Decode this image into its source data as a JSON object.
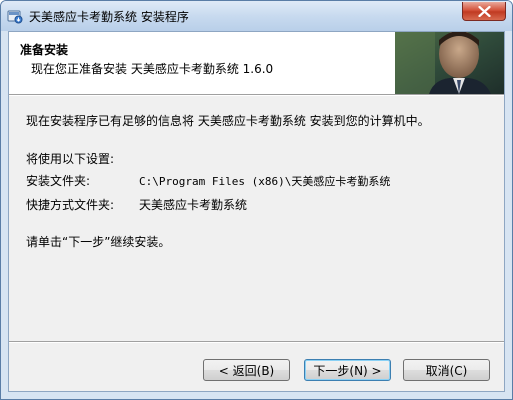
{
  "window": {
    "title": "天美感应卡考勤系统 安装程序"
  },
  "header": {
    "title": "准备安装",
    "subtitle": "现在您正准备安装 天美感应卡考勤系统 1.6.0"
  },
  "body": {
    "intro": "现在安装程序已有足够的信息将 天美感应卡考勤系统 安装到您的计算机中。",
    "settings_heading": "将使用以下设置:",
    "install_folder_label": "安装文件夹:",
    "install_folder_value": "C:\\Program Files (x86)\\天美感应卡考勤系统",
    "shortcut_folder_label": "快捷方式文件夹:",
    "shortcut_folder_value": "天美感应卡考勤系统",
    "continue_prompt": "请单击“下一步”继续安装。"
  },
  "buttons": {
    "back_label": "< 返回(B)",
    "next_label": "下一步(N) >",
    "cancel_label": "取消(C)"
  },
  "icons": {
    "app": "installer-app-icon",
    "close": "close-icon"
  },
  "colors": {
    "titlebar": "#c8daef",
    "close_button": "#c94a32",
    "content_background": "#f0f0f0",
    "header_background": "#ffffff",
    "default_button_border": "#3c7fb1"
  }
}
